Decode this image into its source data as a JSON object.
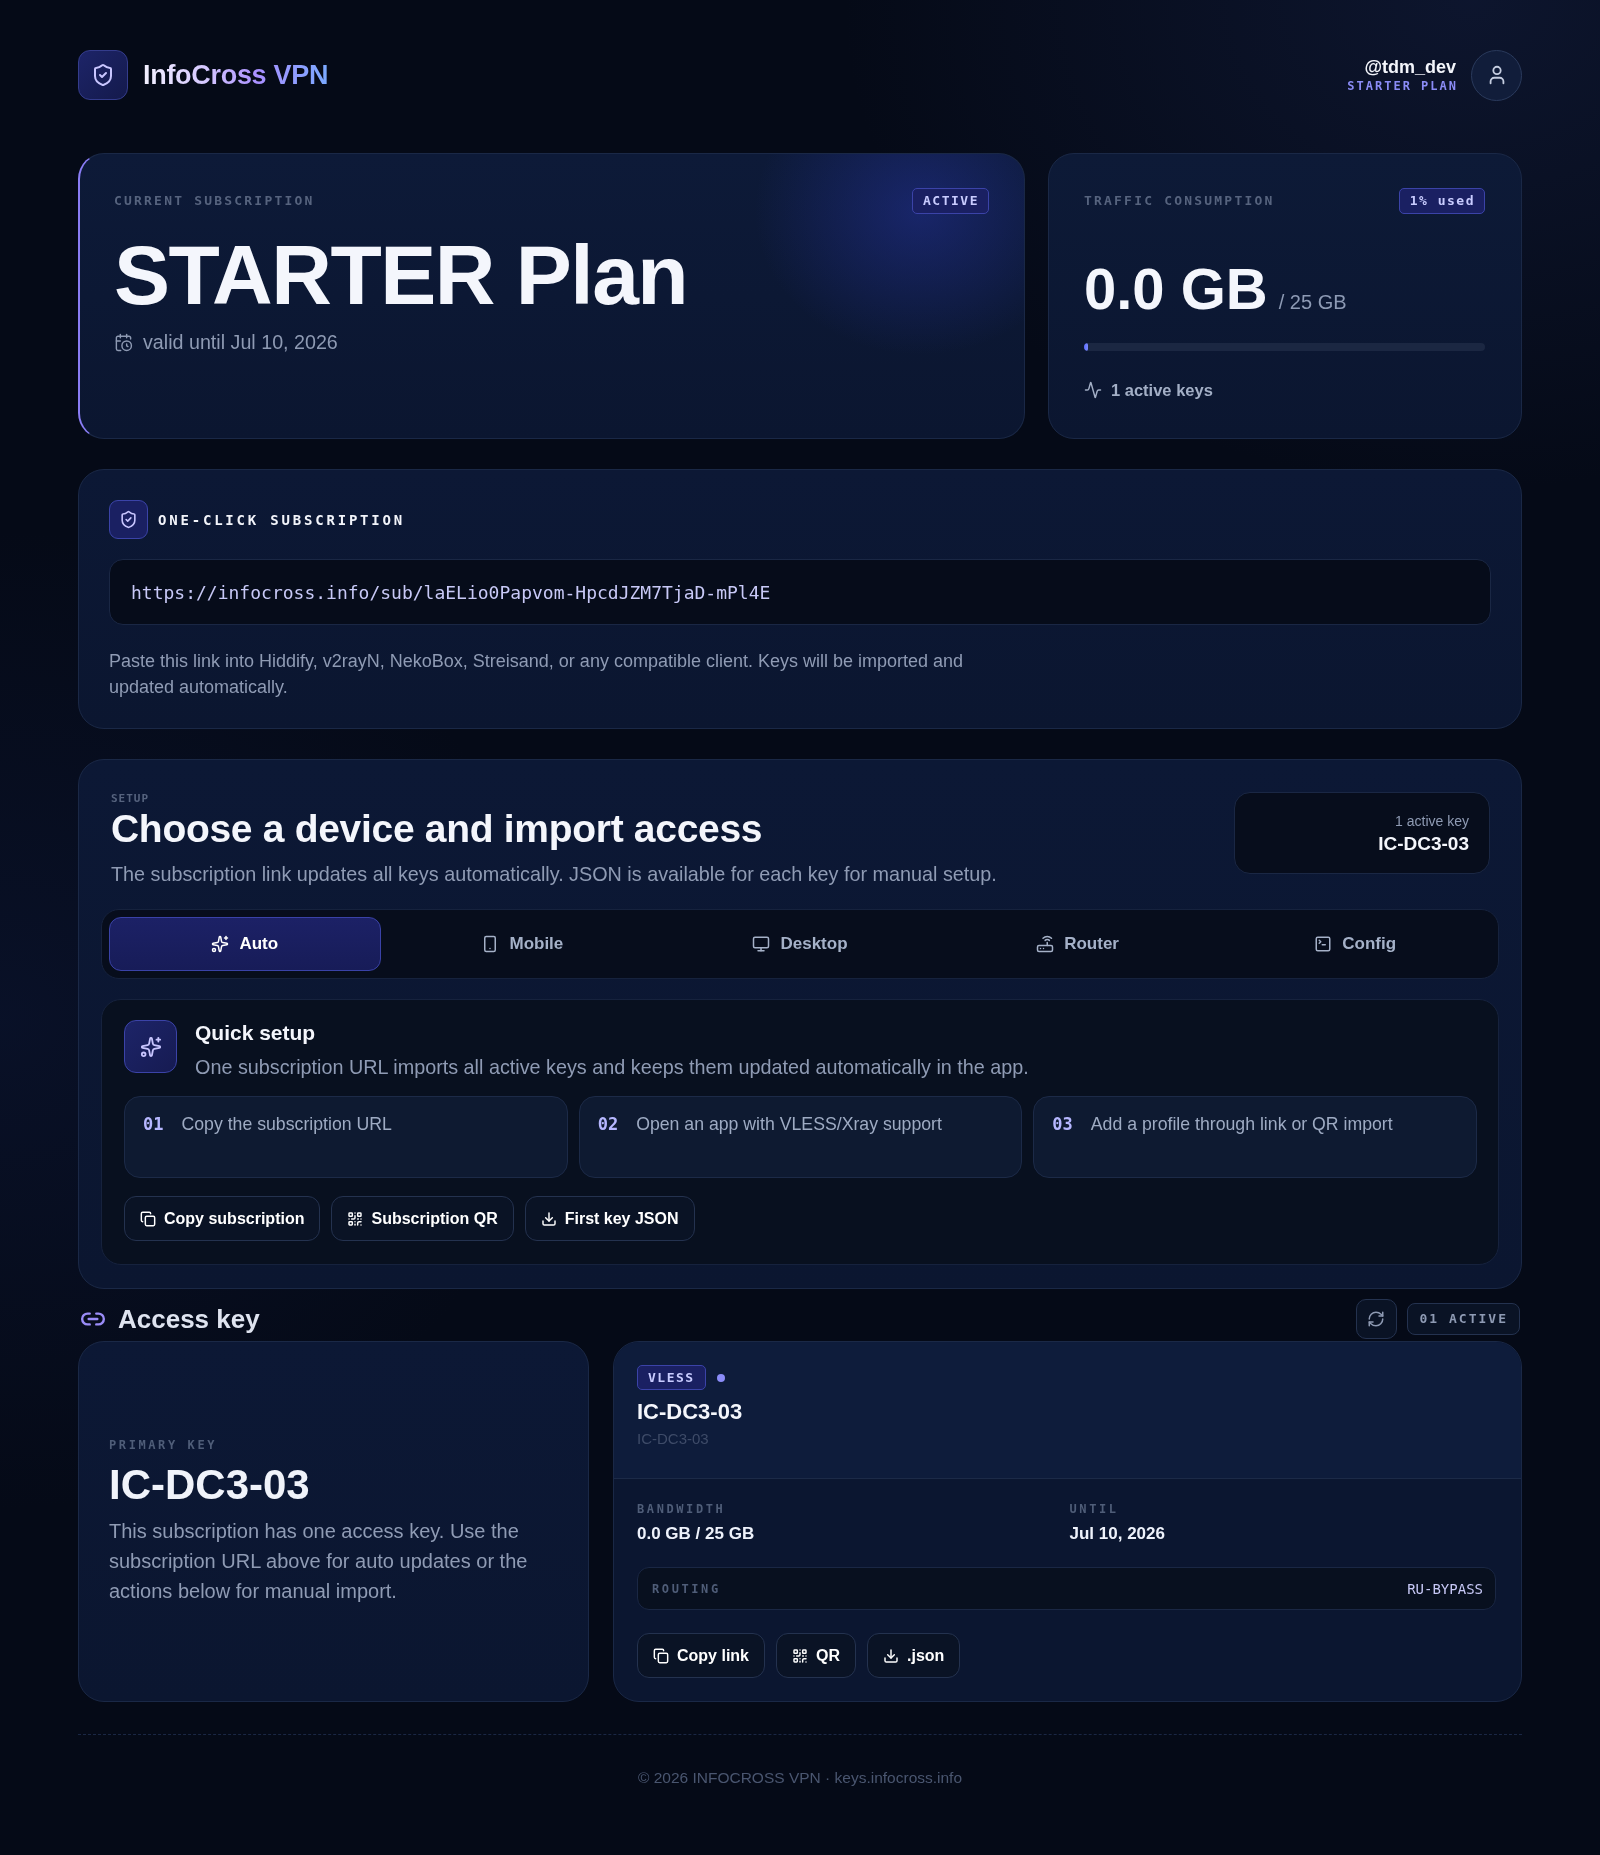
{
  "header": {
    "brand": "InfoCross VPN",
    "user": {
      "name": "@tdm_dev",
      "plan": "STARTER PLAN"
    }
  },
  "subscription": {
    "label": "CURRENT SUBSCRIPTION",
    "status": "ACTIVE",
    "title": "STARTER Plan",
    "valid_until": "valid until Jul 10, 2026"
  },
  "traffic": {
    "label": "TRAFFIC CONSUMPTION",
    "badge": "1% used",
    "used": "0.0 GB",
    "total": "/ 25 GB",
    "level": 0.01,
    "active_keys": "1 active keys"
  },
  "one_click": {
    "title": "ONE-CLICK SUBSCRIPTION",
    "url": "https://infocross.info/sub/laELio0Papvom-HpcdJZM7TjaD-mPl4E",
    "note": "Paste this link into Hiddify, v2rayN, NekoBox, Streisand, or any compatible client. Keys will be imported and updated automatically."
  },
  "setup": {
    "eyebrow": "SETUP",
    "title": "Choose a device and import access",
    "subtitle": "The subscription link updates all keys automatically. JSON is available for each key for manual setup.",
    "key_box": {
      "label": "1 active key",
      "value": "IC-DC3-03"
    },
    "tabs": [
      {
        "kind": "auto",
        "label": "Auto",
        "selected": true
      },
      {
        "kind": "mobile",
        "label": "Mobile",
        "selected": false
      },
      {
        "kind": "desktop",
        "label": "Desktop",
        "selected": false
      },
      {
        "kind": "router",
        "label": "Router",
        "selected": false
      },
      {
        "kind": "config",
        "label": "Config",
        "selected": false
      }
    ],
    "quick_setup": {
      "title": "Quick setup",
      "description": "One subscription URL imports all active keys and keeps them updated automatically in the app.",
      "steps": [
        {
          "number": "01",
          "text": "Copy the subscription URL"
        },
        {
          "number": "02",
          "text": "Open an app with VLESS/Xray support"
        },
        {
          "number": "03",
          "text": "Add a profile through link or QR import"
        }
      ],
      "actions": [
        {
          "kind": "copy",
          "label": "Copy subscription"
        },
        {
          "kind": "qr",
          "label": "Subscription QR"
        },
        {
          "kind": "download",
          "label": "First key JSON"
        }
      ]
    }
  },
  "access_key": {
    "title": "Access key",
    "count": "01 ACTIVE",
    "primary": {
      "label": "PRIMARY KEY",
      "name": "IC-DC3-03",
      "description": "This subscription has one access key. Use the subscription URL above for auto updates or the actions below for manual import."
    },
    "key": {
      "protocol": "VLESS",
      "active": true,
      "name": "IC-DC3-03",
      "id": "IC-DC3-03",
      "fields": [
        {
          "label": "BANDWIDTH",
          "value": "0.0 GB / 25 GB"
        },
        {
          "label": "UNTIL",
          "value": "Jul 10, 2026"
        }
      ],
      "routing": {
        "label": "ROUTING",
        "value": "RU-BYPASS"
      },
      "actions": [
        {
          "kind": "copy",
          "label": "Copy link"
        },
        {
          "kind": "qr",
          "label": "QR"
        },
        {
          "kind": "download",
          "label": ".json"
        }
      ]
    }
  },
  "footer": "© 2026 INFOCROSS VPN · keys.infocross.info"
}
